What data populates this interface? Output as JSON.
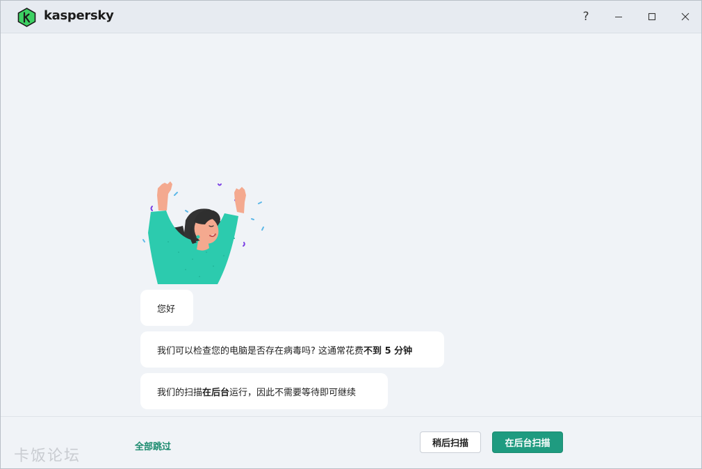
{
  "app": {
    "brand": "kaspersky",
    "help_symbol": "?",
    "accent_color": "#1f9b80",
    "logo_color": "#3dd163"
  },
  "chat": {
    "greeting": "您好",
    "message2_prefix": "我们可以检查您的电脑是否存在病毒吗? 这通常花费",
    "message2_bold": "不到 5 分钟",
    "message3_prefix": "我们的扫描",
    "message3_bold": "在后台",
    "message3_suffix": "运行，因此不需要等待即可继续"
  },
  "footer": {
    "skip_all": "全部跳过",
    "scan_later": "稍后扫描",
    "scan_background": "在后台扫描"
  },
  "watermark": "卡饭论坛",
  "icons": {
    "logo": "kaspersky-logo-icon",
    "help": "help-icon",
    "minimize": "minimize-icon",
    "maximize": "maximize-icon",
    "close": "close-icon"
  }
}
